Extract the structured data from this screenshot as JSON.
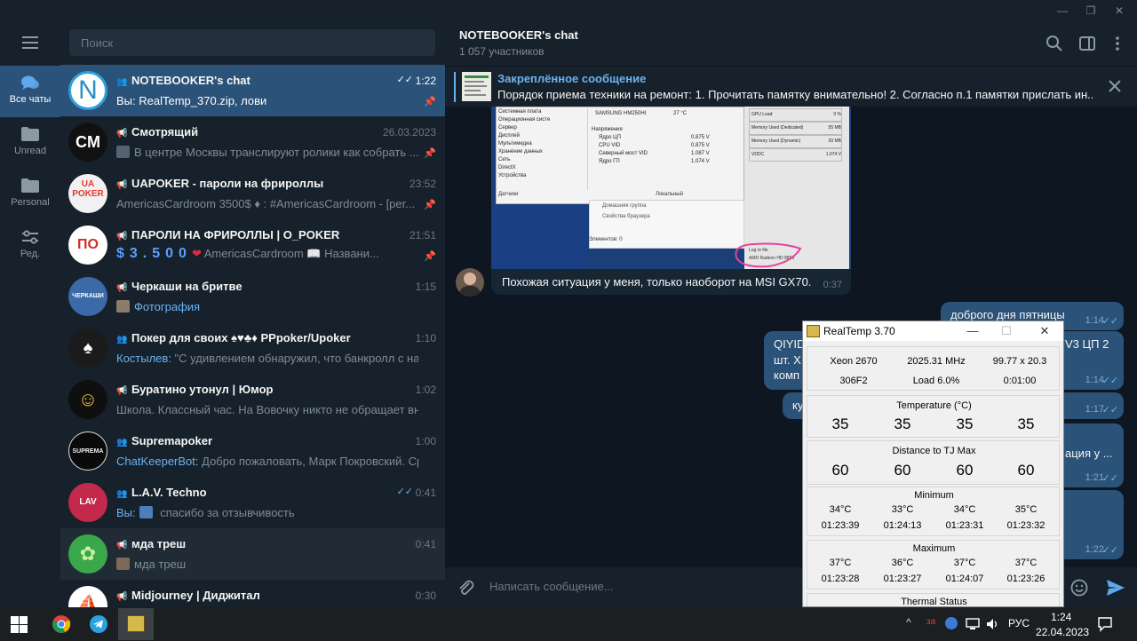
{
  "window": {
    "minimize": "—",
    "restore": "❐",
    "close": "✕"
  },
  "rail": {
    "menu_icon": "hamburger-icon",
    "folders": [
      {
        "label": "Все чаты",
        "icon": "chats-icon"
      },
      {
        "label": "Unread",
        "icon": "folder-icon"
      },
      {
        "label": "Personal",
        "icon": "folder-icon"
      },
      {
        "label": "Ред.",
        "icon": "sliders-icon"
      }
    ]
  },
  "search": {
    "placeholder": "Поиск"
  },
  "chats": [
    {
      "name": "NOTEBOOKER's chat",
      "time": "1:22",
      "who": "Вы:",
      "preview": " RealTemp_370.zip, лови",
      "avatar": "N"
    },
    {
      "name": "Смотрящий",
      "time": "26.03.2023",
      "preview": "В центре Москвы транслируют ролики как собрать ...",
      "avatar": "CM"
    },
    {
      "name": "UAPOKER - пароли на фрироллы",
      "time": "23:52",
      "preview": "AmericasCardroom 3500$ ♦ : #AmericasCardroom - [per...",
      "avatar": "UA POKER"
    },
    {
      "name": "ПАРОЛИ НА ФРИРОЛЛЫ | O_POKER",
      "time": "21:51",
      "digits": "$3.500",
      "heart": "❤",
      "preview": " AmericasCardroom 📖 Названи...",
      "avatar": "ПО"
    },
    {
      "name": "Черкаши на бритве",
      "time": "1:15",
      "who": "Фотография",
      "preview": "",
      "avatar": "ЧЕРКАШИ"
    },
    {
      "name": "Покер для своих ♠♥♣♦ PPpoker/Upoker",
      "time": "1:10",
      "who": "Костылев:",
      "preview": " \"С удивлением обнаружил, что банкролл с начала...",
      "avatar": "♠"
    },
    {
      "name": "Буратино утонул | Юмор",
      "time": "1:02",
      "preview": "Школа. Классный час. На Вовочку никто не обращает вним...",
      "avatar": "☺"
    },
    {
      "name": "Supremapoker",
      "time": "1:00",
      "who": "ChatKeeperBot:",
      "preview": " Добро пожаловать, Марк Покровский.  Сро...",
      "avatar": "SUPREMA"
    },
    {
      "name": "L.A.V. Techno",
      "time": "0:41",
      "who": "Вы:",
      "preview": " спасибо за отзывчивость",
      "avatar": "LAV"
    },
    {
      "name": "мда треш",
      "time": "0:41",
      "preview": "мда треш",
      "avatar": "✿"
    },
    {
      "name": "Midjourney | Диджитал",
      "time": "0:30",
      "preview": "",
      "avatar": "⛵"
    }
  ],
  "chat": {
    "title": "NOTEBOOKER's chat",
    "members": "1 057 участников",
    "pinned_title": "Закреплённое сообщение",
    "pinned_text": "Порядок приема техники на ремонт: 1. Прочитать памятку внимательно! 2. Согласно п.1 памятки прислать ин...",
    "incoming_text": "Похожая ситуация у меня, только наоборот на MSI GX70.",
    "incoming_time": "0:37",
    "photo": {
      "tree": [
        "Системная плата",
        "Операционная систе",
        "Сервер",
        "Дисплей",
        "Мультимедиа",
        "Хранение данных",
        "Сеть",
        "DirectX",
        "Устройства"
      ],
      "drive": "SAMSUNG HM250HI",
      "drive_temp": "27 °C",
      "volt_head": "Напряжения",
      "volts": [
        [
          "Ядро ЦП",
          "0.875 V"
        ],
        [
          "CPU VID",
          "0.875 V"
        ],
        [
          "Северный мост VID",
          "1.087 V"
        ],
        [
          "Ядро ГП",
          "1.074 V"
        ]
      ],
      "gpu_rows": [
        [
          "GPU Load",
          "0 %"
        ],
        [
          "Memory Used (Dedicated)",
          "55 MB"
        ],
        [
          "Memory Used (Dynamic)",
          "20 MB"
        ],
        [
          "VDDC",
          "1.074 V"
        ]
      ],
      "sensors": "Датчики",
      "local": "Локальный",
      "menu": [
        "Домашняя группа",
        "Свойства браузера"
      ],
      "elements": "Элементов: 0",
      "logfile": "Log to file",
      "gpu": "AMD Radeon HD 8850"
    },
    "out_messages": [
      {
        "text": "доброго дня пятницы",
        "time": "1:14"
      },
      {
        "text": "QIYID",
        "extra": "V3 ЦП 2",
        "text2": "шт. Х",
        "text3": "комп",
        "time": "1:14"
      },
      {
        "text": "ку",
        "time": "1:17"
      },
      {
        "text": "ация у ...",
        "time": "1:21"
      },
      {
        "text": "",
        "time": "1:22"
      }
    ],
    "composer_placeholder": "Написать сообщение..."
  },
  "realtemp": {
    "title": "RealTemp 3.70",
    "cpu": "Xeon 2670",
    "freq": "2025.31 MHz",
    "mult": "99.77 x 20.3",
    "cpuid": "306F2",
    "load": "Load  6.0%",
    "uptime": "0:01:00",
    "temp_title": "Temperature (°C)",
    "temps": [
      "35",
      "35",
      "35",
      "35"
    ],
    "dist_title": "Distance to TJ Max",
    "dist": [
      "60",
      "60",
      "60",
      "60"
    ],
    "min_title": "Minimum",
    "min_vals": [
      "34°C",
      "33°C",
      "34°C",
      "35°C"
    ],
    "min_times": [
      "01:23:39",
      "01:24:13",
      "01:23:31",
      "01:23:32"
    ],
    "max_title": "Maximum",
    "max_vals": [
      "37°C",
      "36°C",
      "37°C",
      "37°C"
    ],
    "max_times": [
      "01:23:28",
      "01:23:27",
      "01:24:07",
      "01:23:26"
    ],
    "status_title": "Thermal Status"
  },
  "taskbar": {
    "lang": "РУС",
    "time": "1:24",
    "date": "22.04.2023",
    "badge": "за",
    "caret": "^"
  },
  "colors": {
    "accent": "#2b5278",
    "link": "#6ab3f3",
    "bg": "#0e1621",
    "panel": "#17212b"
  }
}
